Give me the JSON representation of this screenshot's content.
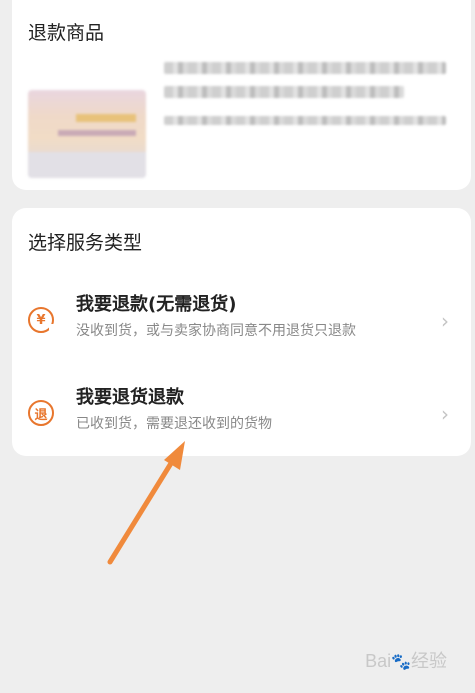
{
  "product_card": {
    "title": "退款商品"
  },
  "service_card": {
    "title": "选择服务类型",
    "options": [
      {
        "icon": "refund-yen-icon",
        "icon_glyph": "¥",
        "title": "我要退款(无需退货)",
        "desc": "没收到货，或与卖家协商同意不用退货只退款",
        "chevron": "›"
      },
      {
        "icon": "return-refund-icon",
        "icon_glyph": "退",
        "title": "我要退货退款",
        "desc": "已收到货，需要退还收到的货物",
        "chevron": "›"
      }
    ]
  },
  "watermark": {
    "brand": "Bai",
    "paw": "🐾",
    "suffix": "经验"
  },
  "colors": {
    "accent": "#e8762d",
    "arrow": "#f08a3c",
    "background": "#eeeeee"
  }
}
